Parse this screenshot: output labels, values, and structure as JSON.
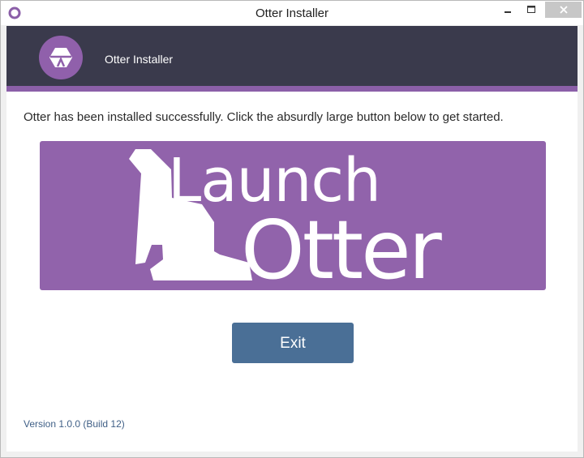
{
  "window": {
    "title": "Otter Installer"
  },
  "header": {
    "title": "Otter Installer"
  },
  "main": {
    "message": "Otter has been installed successfully. Click the absurdly large button below to get started.",
    "launch_button": {
      "line1": "Launch",
      "line2": "Otter"
    },
    "exit_label": "Exit"
  },
  "footer": {
    "version": "Version 1.0.0 (Build 12)"
  },
  "colors": {
    "header_bg": "#3a3a4c",
    "accent_purple": "#9163ab",
    "exit_blue": "#4a6f96",
    "version_text": "#3f5f86"
  },
  "icons": {
    "app": "otter-ring-icon",
    "logo": "otter-hexagon-logo-icon",
    "launch_art": "otter-silhouette-icon"
  }
}
